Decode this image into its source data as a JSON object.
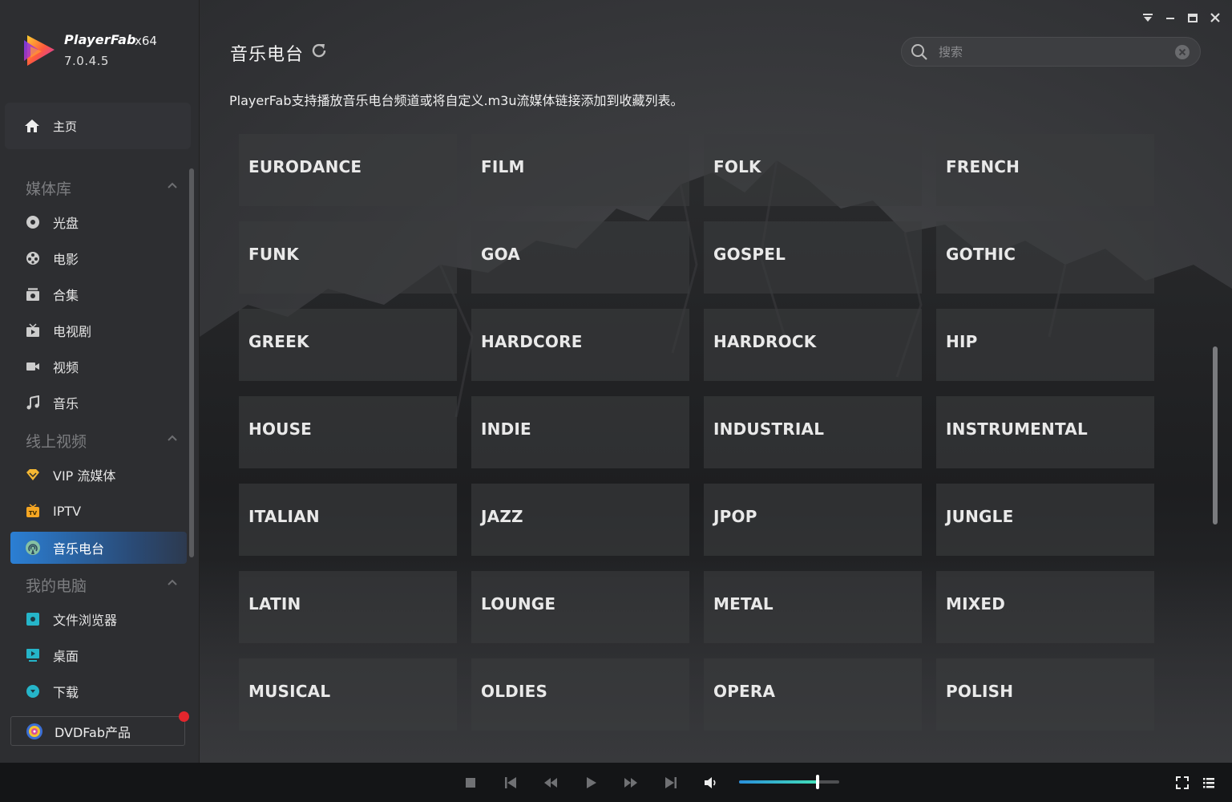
{
  "app": {
    "name": "PlayerFab",
    "arch": "x64",
    "version": "7.0.4.5"
  },
  "sidebar": {
    "home": "主页",
    "sections": [
      {
        "title": "媒体库",
        "items": [
          "光盘",
          "电影",
          "合集",
          "电视剧",
          "视频",
          "音乐"
        ]
      },
      {
        "title": "线上视频",
        "items": [
          "VIP 流媒体",
          "IPTV",
          "音乐电台"
        ]
      },
      {
        "title": "我的电脑",
        "items": [
          "文件浏览器",
          "桌面",
          "下载"
        ]
      }
    ],
    "active_item": "音乐电台",
    "dvdfab": "DVDFab产品"
  },
  "page": {
    "title": "音乐电台",
    "description": "PlayerFab支持播放音乐电台频道或将自定义.m3u流媒体链接添加到收藏列表。",
    "search": {
      "placeholder": "搜索",
      "value": ""
    }
  },
  "genres": [
    "EURODANCE",
    "FILM",
    "FOLK",
    "FRENCH",
    "FUNK",
    "GOA",
    "GOSPEL",
    "GOTHIC",
    "GREEK",
    "HARDCORE",
    "HARDROCK",
    "HIP",
    "HOUSE",
    "INDIE",
    "INDUSTRIAL",
    "INSTRUMENTAL",
    "ITALIAN",
    "JAZZ",
    "JPOP",
    "JUNGLE",
    "LATIN",
    "LOUNGE",
    "METAL",
    "MIXED",
    "MUSICAL",
    "OLDIES",
    "OPERA",
    "POLISH"
  ],
  "player": {
    "volume": 0.78
  },
  "colors": {
    "accent": "#2b7fd4",
    "volume_start": "#2a8fdb",
    "volume_end": "#42e0b9",
    "notification": "#e3262d"
  }
}
